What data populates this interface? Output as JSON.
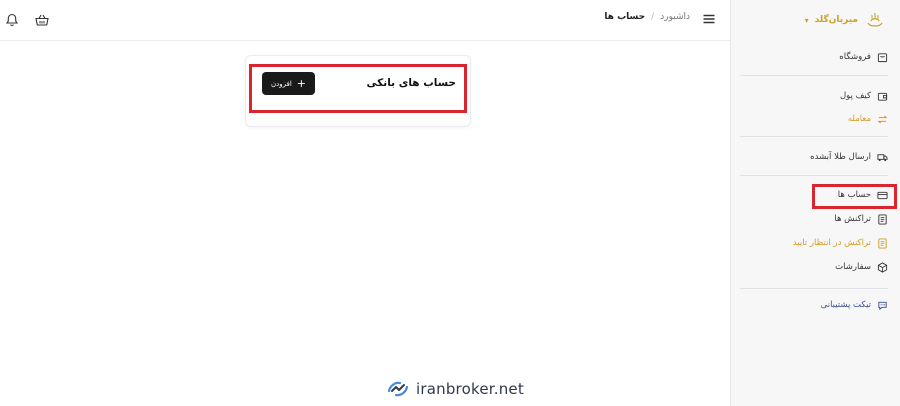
{
  "brand": {
    "name": "میربان‌گلد",
    "color": "#c9a227"
  },
  "topbar": {
    "breadcrumb": [
      "داشبورد",
      "حساب ها"
    ],
    "separator": "/",
    "icons": [
      "bell-icon",
      "basket-icon",
      "menu-icon"
    ]
  },
  "sidebar": {
    "items": [
      {
        "label": "فروشگاه",
        "icon": "store-icon"
      },
      {
        "label": "کیف پول",
        "icon": "wallet-icon"
      },
      {
        "label": "معامله",
        "icon": "exchange-icon",
        "accent": "#d69a1e"
      },
      {
        "label": "ارسال طلا آبشده",
        "icon": "truck-icon"
      },
      {
        "label": "حساب ها",
        "icon": "card-icon",
        "active": true
      },
      {
        "label": "تراکنش ها",
        "icon": "document-icon"
      },
      {
        "label": "تراکنش در انتظار تایید",
        "icon": "pending-document-icon",
        "accent": "#d69a1e"
      },
      {
        "label": "سفارشات",
        "icon": "box-icon"
      },
      {
        "label": "تیکت پشتیبانی",
        "icon": "support-icon",
        "accent": "#3a4f8c"
      }
    ]
  },
  "card": {
    "title": "حساب های بانکی",
    "add_label": "افزودن"
  },
  "watermark": {
    "text": "iranbroker.net"
  },
  "colors": {
    "highlight": "#d9262e",
    "button": "#1a1a1a"
  }
}
